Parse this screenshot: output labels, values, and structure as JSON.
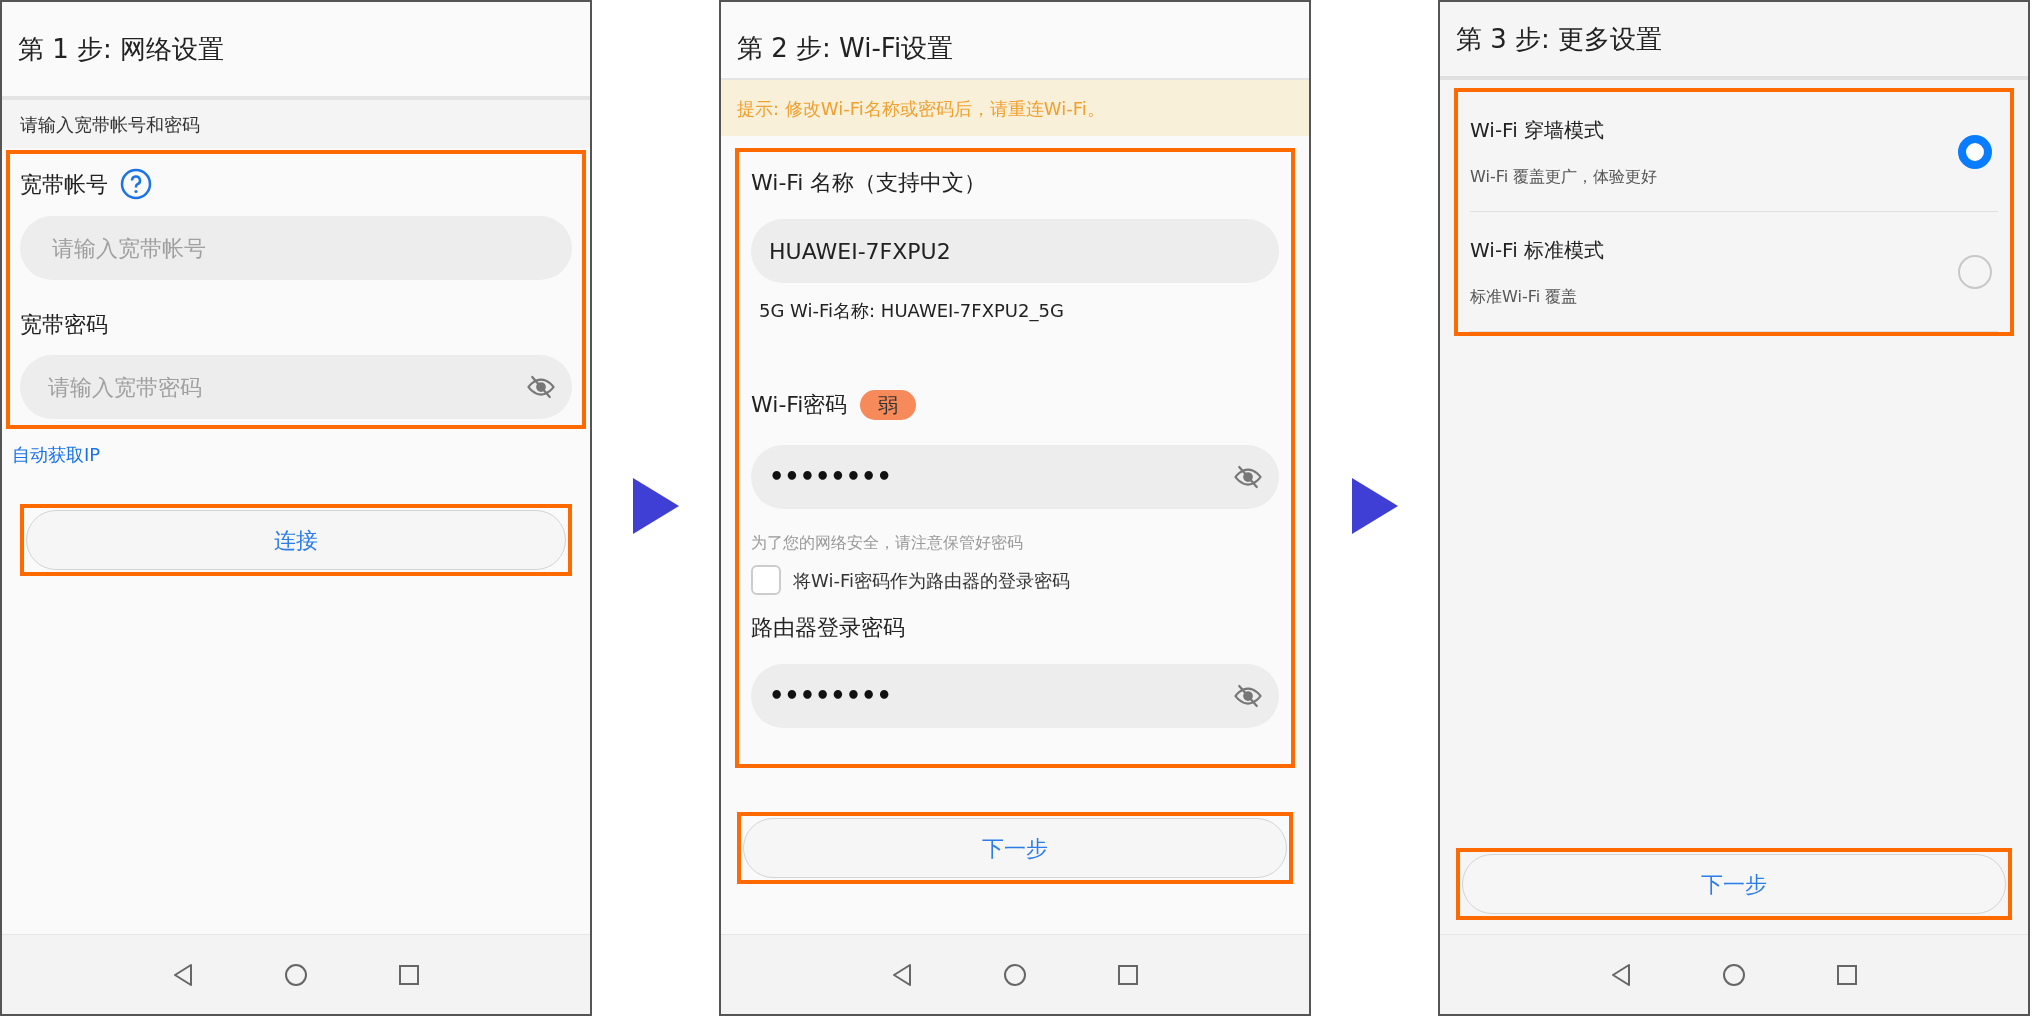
{
  "step1": {
    "title": "第 1 步: 网络设置",
    "subtitle": "请输入宽带帐号和密码",
    "account": {
      "label": "宽带帐号",
      "placeholder": "请输入宽带帐号"
    },
    "password": {
      "label": "宽带密码",
      "placeholder": "请输入宽带密码"
    },
    "auto_ip_link": "自动获取IP",
    "connect_button": "连接"
  },
  "step2": {
    "title": "第 2 步: Wi-Fi设置",
    "tip": "提示: 修改Wi-Fi名称或密码后，请重连Wi-Fi。",
    "wifi_name": {
      "label": "Wi-Fi 名称（支持中文）",
      "value": "HUAWEI-7FXPU2"
    },
    "wifi_5g_name": "5G Wi-Fi名称: HUAWEI-7FXPU2_5G",
    "wifi_password": {
      "label": "Wi-Fi密码",
      "strength": "弱",
      "value": "••••••••"
    },
    "security_hint": "为了您的网络安全，请注意保管好密码",
    "same_password_checkbox": {
      "label": "将Wi-Fi密码作为路由器的登录密码",
      "checked": false
    },
    "router_password": {
      "label": "路由器登录密码",
      "value": "••••••••"
    },
    "next_button": "下一步"
  },
  "step3": {
    "title": "第 3 步: 更多设置",
    "modes": [
      {
        "title": "Wi-Fi 穿墙模式",
        "description": "Wi-Fi 覆盖更广，体验更好",
        "selected": true
      },
      {
        "title": "Wi-Fi 标准模式",
        "description": "标准Wi-Fi 覆盖",
        "selected": false
      }
    ],
    "next_button": "下一步"
  }
}
